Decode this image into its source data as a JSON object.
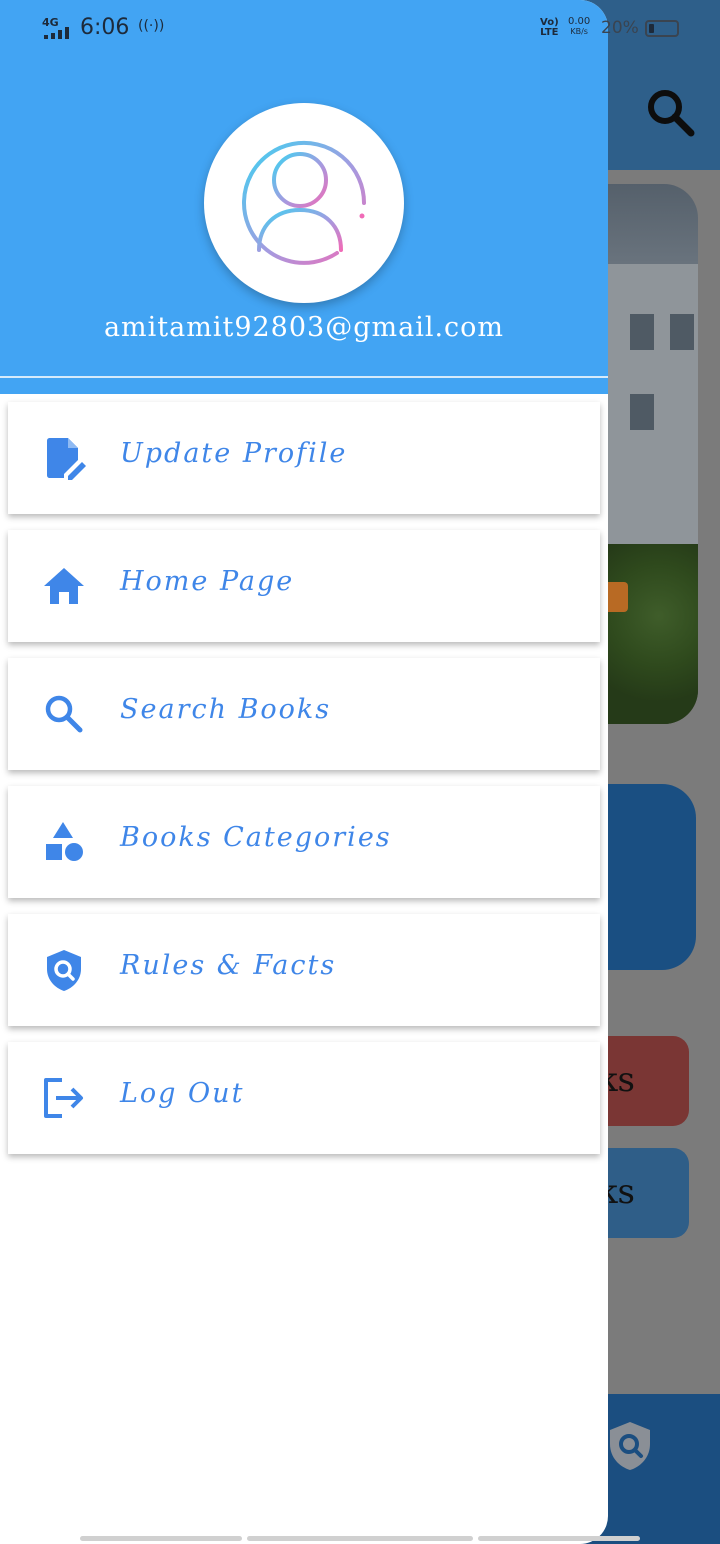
{
  "status_bar": {
    "network": "4G",
    "time": "6:06",
    "hotspot": "((·))",
    "volte_top": "Vo)",
    "volte_bottom": "LTE",
    "speed_value": "0.00",
    "speed_unit": "KB/s",
    "battery_percent": "20%",
    "battery_level": 0.2
  },
  "drawer": {
    "email": "amitamit92803@gmail.com",
    "menu": [
      {
        "label": "Update Profile",
        "icon": "edit-document-icon"
      },
      {
        "label": "Home Page",
        "icon": "home-icon"
      },
      {
        "label": "Search Books",
        "icon": "search-icon"
      },
      {
        "label": "Books Categories",
        "icon": "categories-icon"
      },
      {
        "label": "Rules & Facts",
        "icon": "shield-search-icon"
      },
      {
        "label": "Log Out",
        "icon": "logout-icon"
      }
    ]
  },
  "background": {
    "button_1_text": "oks",
    "button_2_text": "oks"
  },
  "colors": {
    "header_blue": "#42a4f3",
    "menu_text_blue": "#3f86e8"
  }
}
